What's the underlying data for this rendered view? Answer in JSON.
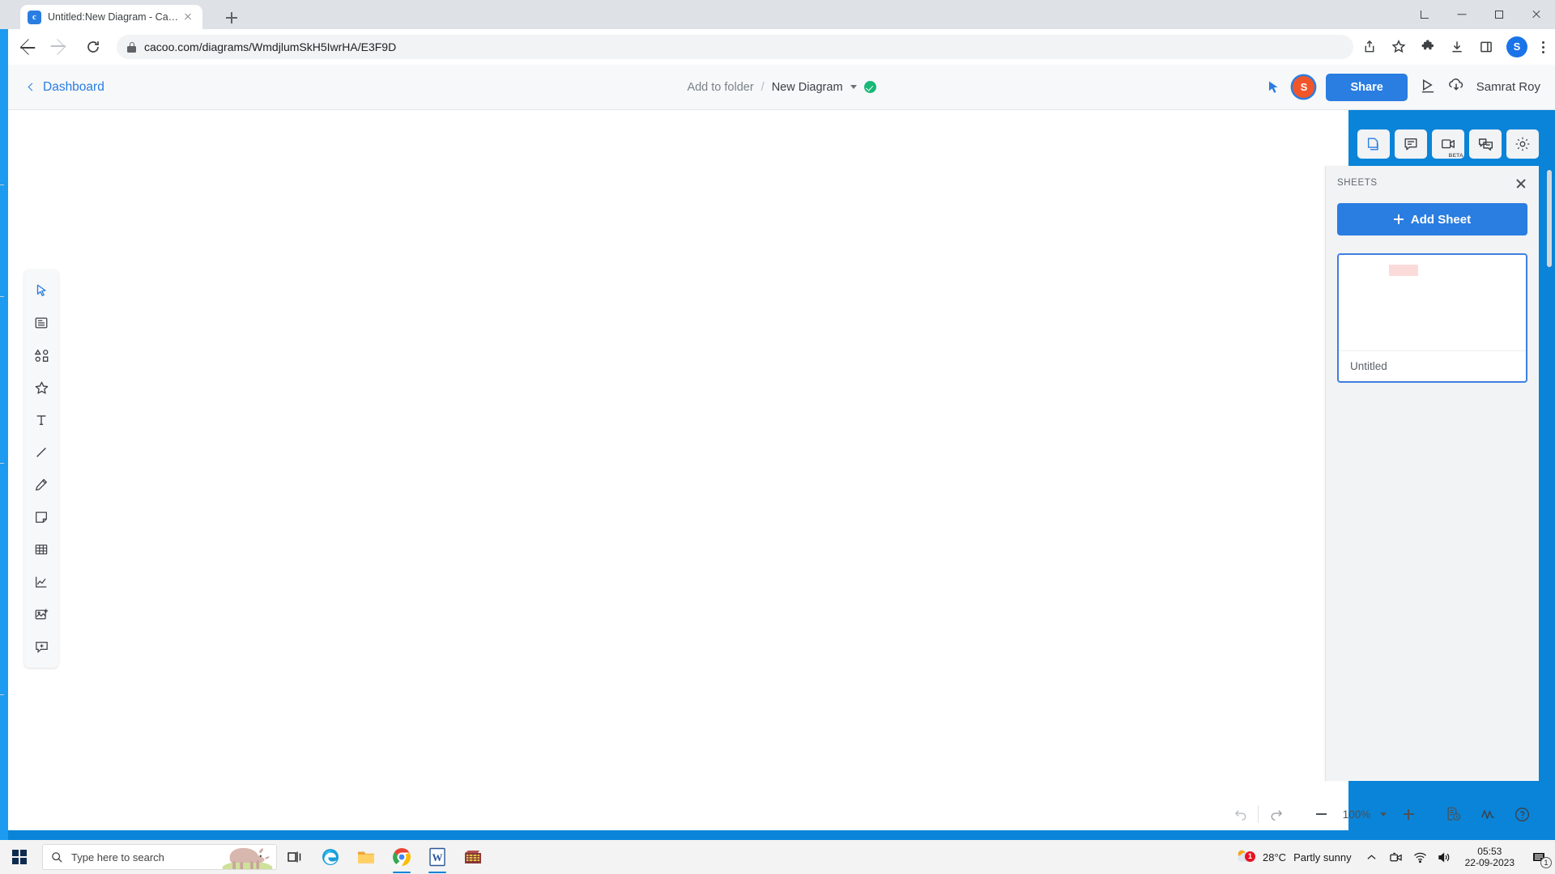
{
  "browser": {
    "tab": {
      "title": "Untitled:New Diagram - Cacoo",
      "favicon_letter": "c",
      "favicon_name": "cacoo-favicon"
    },
    "newtab_label": "+",
    "url": "cacoo.com/diagrams/WmdjlumSkH5IwrHA/E3F9D",
    "profile_letter": "S",
    "window_controls": [
      "chevron-down",
      "minimize",
      "maximize",
      "close"
    ],
    "toolbar_icons": [
      "share-icon",
      "bookmark-star-icon",
      "extensions-puzzle-icon",
      "downloads-icon",
      "sidepanel-icon"
    ]
  },
  "app_header": {
    "dashboard_label": "Dashboard",
    "add_to_folder_label": "Add to folder",
    "separator": "/",
    "diagram_name": "New Diagram",
    "share_label": "Share",
    "user_name": "Samrat Roy",
    "avatar_letter": "S",
    "accent_color": "#2a7de1",
    "saved_color": "#18b877"
  },
  "left_toolbar": {
    "tools": [
      {
        "name": "select-tool",
        "active": true
      },
      {
        "name": "template-tool",
        "active": false
      },
      {
        "name": "shapes-tool",
        "active": false
      },
      {
        "name": "favorites-tool",
        "active": false
      },
      {
        "name": "text-tool",
        "active": false
      },
      {
        "name": "line-tool",
        "active": false
      },
      {
        "name": "pen-tool",
        "active": false
      },
      {
        "name": "sticky-note-tool",
        "active": false
      },
      {
        "name": "table-tool",
        "active": false
      },
      {
        "name": "chart-tool",
        "active": false
      },
      {
        "name": "image-tool",
        "active": false
      },
      {
        "name": "comment-tool",
        "active": false
      }
    ]
  },
  "panel_tabs": [
    {
      "name": "sheets-tab",
      "icon": "sheets-icon",
      "active": true,
      "tag": ""
    },
    {
      "name": "comments-tab",
      "icon": "comment-icon",
      "active": false,
      "tag": ""
    },
    {
      "name": "video-chat-tab",
      "icon": "video-icon",
      "active": false,
      "tag": "BETA"
    },
    {
      "name": "chat-tab",
      "icon": "chat-icon",
      "active": false,
      "tag": ""
    },
    {
      "name": "settings-tab",
      "icon": "gear-icon",
      "active": false,
      "tag": ""
    }
  ],
  "sheets_panel": {
    "title": "SHEETS",
    "add_sheet_label": "Add Sheet",
    "sheets": [
      {
        "name": "Untitled",
        "selected": true
      }
    ]
  },
  "bottom_bar": {
    "zoom_level": "100%",
    "buttons": [
      "undo-icon",
      "redo-icon",
      "zoom-out-icon",
      "zoom-in-icon",
      "revision-history-icon",
      "activity-icon",
      "help-icon"
    ]
  },
  "taskbar": {
    "search_placeholder": "Type here to search",
    "apps": [
      "task-view-icon",
      "edge-icon",
      "file-explorer-icon",
      "chrome-icon",
      "word-icon",
      "winrar-icon"
    ],
    "weather": {
      "temperature": "28°C",
      "description": "Partly sunny",
      "badge": "1"
    },
    "time": "05:53",
    "date": "22-09-2023",
    "notification_count": "1"
  }
}
